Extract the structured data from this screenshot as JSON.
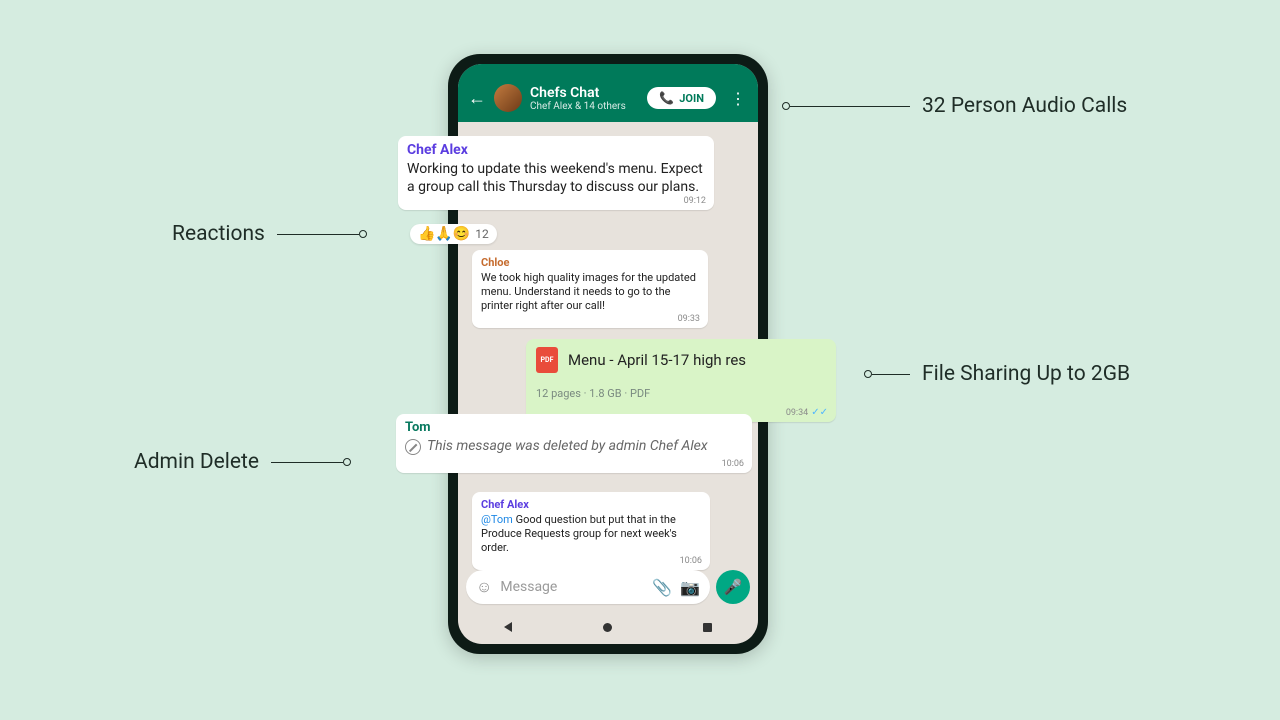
{
  "annotations": {
    "reactions": "Reactions",
    "admin_delete": "Admin Delete",
    "audio_calls": "32 Person Audio Calls",
    "file_sharing": "File Sharing Up to 2GB"
  },
  "header": {
    "title": "Chefs Chat",
    "subtitle": "Chef Alex & 14 others",
    "join_label": "JOIN"
  },
  "messages": {
    "m1": {
      "sender": "Chef Alex",
      "body": "Working to update this weekend's menu. Expect a group call this Thursday to discuss our plans.",
      "time": "09:12"
    },
    "reactions": {
      "emojis": "👍🙏😊",
      "count": "12"
    },
    "m2": {
      "sender": "Chloe",
      "body": "We took high quality images for the updated menu. Understand it needs to go to the printer right after our call!",
      "time": "09:33"
    },
    "file": {
      "icon_label": "PDF",
      "name": "Menu - April 15-17 high res",
      "meta": "12 pages · 1.8 GB · PDF",
      "time": "09:34"
    },
    "deleted": {
      "sender": "Tom",
      "body": "This message was deleted by admin Chef Alex",
      "time": "10:06"
    },
    "m5": {
      "sender": "Chef Alex",
      "mention": "@Tom",
      "body": " Good question but put that in the Produce Requests group for next week's order.",
      "time": "10:06"
    }
  },
  "input": {
    "placeholder": "Message"
  }
}
